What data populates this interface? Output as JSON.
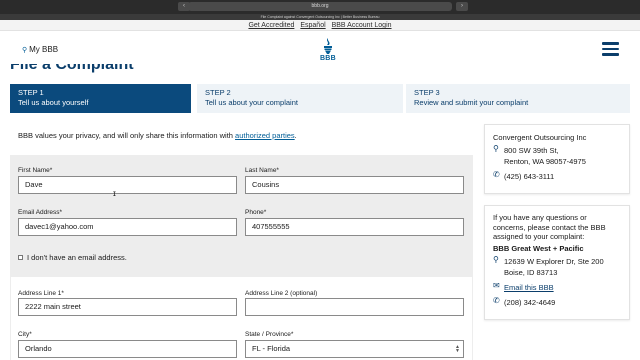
{
  "browser": {
    "url": "bbb.org",
    "tab_title": "File Complaint against Convergent Outsourcing Inc | Better Business Bureau"
  },
  "utility_bar": {
    "links": [
      "Get Accredited",
      "Español",
      "BBB Account Login"
    ]
  },
  "header": {
    "my_bbb": "My BBB",
    "logo_text": "BBB"
  },
  "page": {
    "title": "File a Complaint"
  },
  "steps": [
    {
      "num": "STEP 1",
      "label": "Tell us about yourself",
      "active": true
    },
    {
      "num": "STEP 2",
      "label": "Tell us about your complaint",
      "active": false
    },
    {
      "num": "STEP 3",
      "label": "Review and submit your complaint",
      "active": false
    }
  ],
  "form": {
    "privacy_text": "BBB values your privacy, and will only share this information with ",
    "privacy_link": "authorized parties",
    "privacy_end": ".",
    "first_name": {
      "label": "First Name*",
      "value": "Dave"
    },
    "last_name": {
      "label": "Last Name*",
      "value": "Cousins"
    },
    "email": {
      "label": "Email Address*",
      "value": "davec1@yahoo.com"
    },
    "phone": {
      "label": "Phone*",
      "value": "407555555"
    },
    "no_email_label": "I don't have an email address.",
    "address1": {
      "label": "Address Line 1*",
      "value": "2222 main street"
    },
    "address2": {
      "label": "Address Line 2 (optional)",
      "value": ""
    },
    "city": {
      "label": "City*",
      "value": "Orlando"
    },
    "state": {
      "label": "State / Province*",
      "value": "FL - Florida"
    }
  },
  "business_card": {
    "name": "Convergent Outsourcing Inc",
    "address1": "800 SW 39th St,",
    "address2": "Renton, WA 98057-4975",
    "phone": "(425) 643-3111"
  },
  "bbb_card": {
    "intro_lines": [
      "If you have any questions or",
      "concerns, please contact the BBB",
      "assigned to your complaint:"
    ],
    "bbb_name": "BBB Great West + Pacific",
    "address1": "12639 W Explorer Dr, Ste 200",
    "address2": "Boise, ID 83713",
    "email_link": "Email this BBB",
    "phone": "(208) 342-4649"
  }
}
